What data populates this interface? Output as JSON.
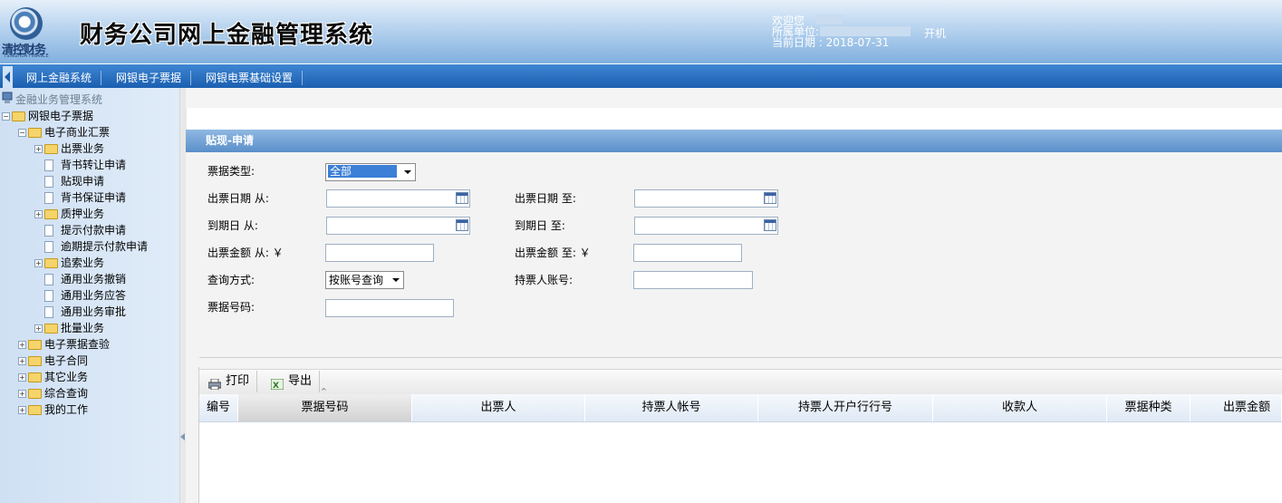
{
  "header": {
    "logo_text": "清控财务",
    "logo_subtitle": "TSINGHUA FINANCE",
    "app_title": "财务公司网上金融管理系统",
    "welcome_label": "欢迎您",
    "unit_label": "所属单位:",
    "unit_suffix": "开机",
    "date_label": "当前日期 : 2018-07-31"
  },
  "tabs": [
    "网上金融系统",
    "网银电子票据",
    "网银电票基础设置"
  ],
  "sidebar": {
    "root": "金融业务管理系统",
    "items": [
      {
        "label": "网银电子票据",
        "level": 0,
        "kind": "folder",
        "toggle": "−"
      },
      {
        "label": "电子商业汇票",
        "level": 1,
        "kind": "folder",
        "toggle": "−"
      },
      {
        "label": "出票业务",
        "level": 2,
        "kind": "folder",
        "toggle": "+"
      },
      {
        "label": "背书转让申请",
        "level": 2,
        "kind": "doc"
      },
      {
        "label": "贴现申请",
        "level": 2,
        "kind": "doc"
      },
      {
        "label": "背书保证申请",
        "level": 2,
        "kind": "doc"
      },
      {
        "label": "质押业务",
        "level": 2,
        "kind": "folder",
        "toggle": "+"
      },
      {
        "label": "提示付款申请",
        "level": 2,
        "kind": "doc"
      },
      {
        "label": "逾期提示付款申请",
        "level": 2,
        "kind": "doc"
      },
      {
        "label": "追索业务",
        "level": 2,
        "kind": "folder",
        "toggle": "+"
      },
      {
        "label": "通用业务撤销",
        "level": 2,
        "kind": "doc"
      },
      {
        "label": "通用业务应答",
        "level": 2,
        "kind": "doc"
      },
      {
        "label": "通用业务审批",
        "level": 2,
        "kind": "doc"
      },
      {
        "label": "批量业务",
        "level": 2,
        "kind": "folder",
        "toggle": "+"
      },
      {
        "label": "电子票据查验",
        "level": 1,
        "kind": "folder",
        "toggle": "+"
      },
      {
        "label": "电子合同",
        "level": 1,
        "kind": "folder",
        "toggle": "+"
      },
      {
        "label": "其它业务",
        "level": 1,
        "kind": "folder",
        "toggle": "+"
      },
      {
        "label": "综合查询",
        "level": 1,
        "kind": "folder",
        "toggle": "+"
      },
      {
        "label": "我的工作",
        "level": 1,
        "kind": "folder",
        "toggle": "+"
      }
    ]
  },
  "form": {
    "panel_title": "贴现-申请",
    "bill_type_label": "票据类型:",
    "bill_type_value": "全部",
    "issue_date_from_label": "出票日期 从:",
    "issue_date_to_label": "出票日期 至:",
    "due_date_from_label": "到期日 从:",
    "due_date_to_label": "到期日 至:",
    "amount_from_label": "出票金额 从: ￥",
    "amount_to_label": "出票金额 至: ￥",
    "query_mode_label": "查询方式:",
    "query_mode_value": "按账号查询",
    "holder_account_label": "持票人账号:",
    "bill_number_label": "票据号码:"
  },
  "toolbar": {
    "print_label": "打印",
    "export_label": "导出"
  },
  "table": {
    "columns": [
      "编号",
      "票据号码",
      "出票人",
      "持票人帐号",
      "持票人开户行行号",
      "收款人",
      "票据种类",
      "出票金额"
    ]
  }
}
